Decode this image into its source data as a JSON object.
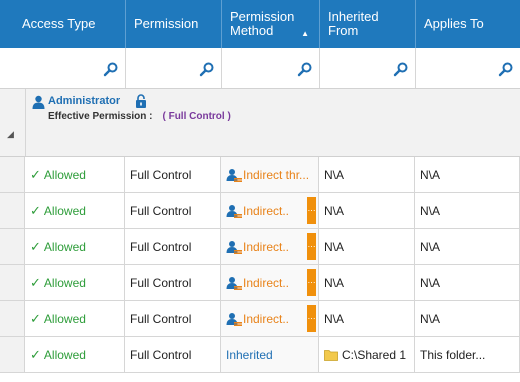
{
  "columns": [
    {
      "key": "access_type",
      "label": "Access Type"
    },
    {
      "key": "permission",
      "label": "Permission"
    },
    {
      "key": "permission_method",
      "label": "Permission Method"
    },
    {
      "key": "inherited_from",
      "label": "Inherited From"
    },
    {
      "key": "applies_to",
      "label": "Applies To"
    }
  ],
  "group": {
    "user": "Administrator",
    "effective_label": "Effective Permission :",
    "effective_value": "( Full Control )"
  },
  "rows": [
    {
      "access": "Allowed",
      "permission": "Full Control",
      "method": "Indirect thr...",
      "method_type": "indirect",
      "has_more": false,
      "inherited_from": "N\\A",
      "applies_to": "N\\A"
    },
    {
      "access": "Allowed",
      "permission": "Full Control",
      "method": "Indirect..",
      "method_type": "indirect",
      "has_more": true,
      "inherited_from": "N\\A",
      "applies_to": "N\\A"
    },
    {
      "access": "Allowed",
      "permission": "Full Control",
      "method": "Indirect..",
      "method_type": "indirect",
      "has_more": true,
      "inherited_from": "N\\A",
      "applies_to": "N\\A"
    },
    {
      "access": "Allowed",
      "permission": "Full Control",
      "method": "Indirect..",
      "method_type": "indirect",
      "has_more": true,
      "inherited_from": "N\\A",
      "applies_to": "N\\A"
    },
    {
      "access": "Allowed",
      "permission": "Full Control",
      "method": "Indirect..",
      "method_type": "indirect",
      "has_more": true,
      "inherited_from": "N\\A",
      "applies_to": "N\\A"
    },
    {
      "access": "Allowed",
      "permission": "Full Control",
      "method": "Inherited",
      "method_type": "inherited",
      "has_more": false,
      "inherited_from": "C:\\Shared 1",
      "inherited_folder": true,
      "applies_to": "This folder..."
    }
  ],
  "icons": {
    "sort": "sort-arrow-icon",
    "filter": "search-icon",
    "user": "user-icon",
    "lock": "lock-icon",
    "check": "checkmark-icon",
    "indirect": "group-users-icon",
    "folder": "folder-icon",
    "more": "ellipsis-icon"
  },
  "colors": {
    "header_bg": "#1f79bd",
    "allowed": "#2e9d3a",
    "indirect": "#e8831a",
    "inherited": "#1f6fb3",
    "effective": "#7a3a9c",
    "more_btn": "#f0900c"
  }
}
